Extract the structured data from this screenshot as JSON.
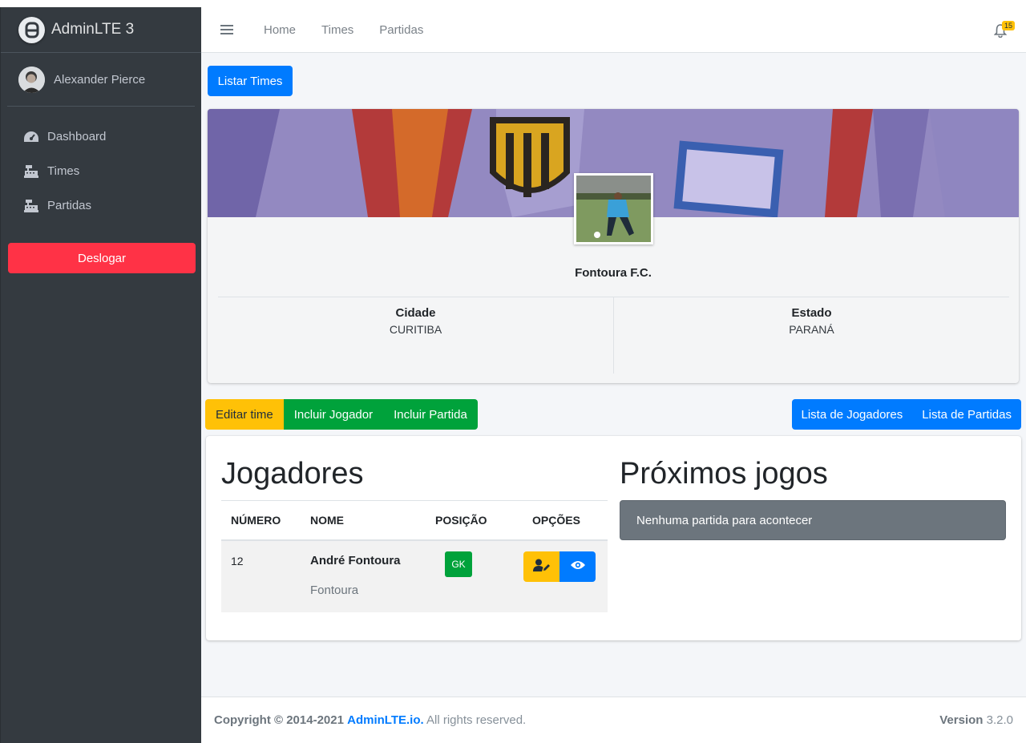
{
  "sidebar": {
    "brand": "AdminLTE 3",
    "user_name": "Alexander Pierce",
    "items": [
      {
        "label": "Dashboard",
        "icon": "tachometer-icon"
      },
      {
        "label": "Times",
        "icon": "cash-register-icon"
      },
      {
        "label": "Partidas",
        "icon": "cash-register-icon"
      }
    ],
    "logout_label": "Deslogar"
  },
  "navbar": {
    "links": [
      "Home",
      "Times",
      "Partidas"
    ],
    "notification_count": "15"
  },
  "page": {
    "list_button": "Listar Times",
    "team_name": "Fontoura F.C.",
    "city_label": "Cidade",
    "city_value": "CURITIBA",
    "state_label": "Estado",
    "state_value": "PARANÁ",
    "actions_left": [
      "Editar time",
      "Incluir Jogador",
      "Incluir Partida"
    ],
    "actions_right": [
      "Lista de Jogadores",
      "Lista de Partidas"
    ]
  },
  "players": {
    "title": "Jogadores",
    "headers": [
      "NÚMERO",
      "NOME",
      "POSIÇÃO",
      "OPÇÕES"
    ],
    "rows": [
      {
        "number": "12",
        "name": "André Fontoura",
        "nickname": "Fontoura",
        "position": "GK"
      }
    ]
  },
  "games": {
    "title": "Próximos jogos",
    "empty_message": "Nenhuma partida para acontecer"
  },
  "footer": {
    "copyright_prefix": "Copyright © 2014-2021",
    "copyright_link": "AdminLTE.io.",
    "copyright_suffix": "All rights reserved.",
    "version_label": "Version",
    "version_value": "3.2.0"
  },
  "colors": {
    "sidebar_bg": "#343a40",
    "primary": "#007bff",
    "success": "#00a23b",
    "warning": "#ffc107",
    "danger": "#ff3246",
    "secondary": "#6c757d"
  }
}
